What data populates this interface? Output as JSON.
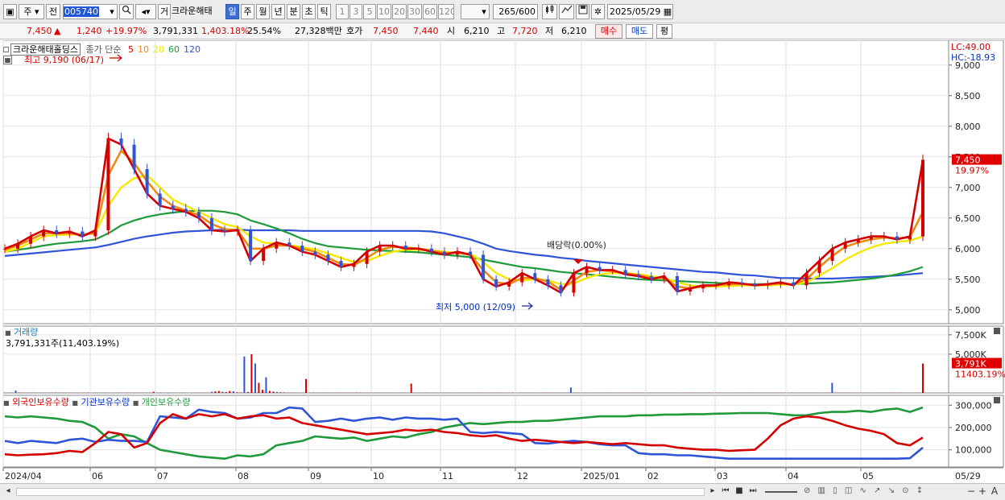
{
  "toolbar": {
    "mode_label": "주",
    "prev_label": "전",
    "code": "005740",
    "trade_label": "거",
    "stock_name": "크라운해태",
    "period_tabs": [
      "일",
      "주",
      "월",
      "년",
      "분",
      "초",
      "틱"
    ],
    "active_period": "일",
    "minute_steps": [
      "1",
      "3",
      "5",
      "10",
      "20",
      "30",
      "60",
      "120"
    ],
    "count": "265",
    "count_max": "/600",
    "date": "2025/05/29"
  },
  "quote": {
    "price": "7,450",
    "arrow": "▲",
    "change": "1,240",
    "change_pct": "+19.97%",
    "volume": "3,791,331",
    "volume_pct": "1,403.18%",
    "turnover": "25.54%",
    "amount": "27,328백만",
    "bid_label": "호가",
    "ask_price": "7,450",
    "bid_price": "7,440",
    "open_label": "시",
    "open": "6,210",
    "high_label": "고",
    "high": "7,720",
    "low_label": "저",
    "low": "6,210",
    "buy_label": "매수",
    "sell_label": "매도",
    "eval_label": "평"
  },
  "price_panel": {
    "name_tag": "크라운해태홀딩스",
    "ma_title": "종가 단순",
    "ma_periods": [
      "5",
      "10",
      "20",
      "60",
      "120"
    ],
    "ma_colors": [
      "#d40000",
      "#ee8a10",
      "#f5e800",
      "#1e9a3a",
      "#2f54d8"
    ],
    "high_note": "최고 9,190 (06/17)",
    "low_note": "최저 5,000 (12/09)",
    "dividend_note": "배당락(0.00%)",
    "lc": "LC:49.00",
    "hc": "HC:-18.93",
    "last_price_tag": "7,450",
    "last_pct_tag": "19.97%"
  },
  "volume_panel": {
    "title": "거래량",
    "value": "3,791,331주(11,403.19%)",
    "last_tag": "3,791K",
    "last_pct": "11403.19%"
  },
  "holding_panel": {
    "titles": [
      "외국인보유수량",
      "기관보유수량",
      "개인보유수량"
    ],
    "colors": [
      "#d40000",
      "#2f54d8",
      "#1e9a3a"
    ]
  },
  "bottombar": {
    "nav_icons": [
      "scroll-left-icon",
      "scroll-right-icon",
      "first-icon",
      "stop-icon",
      "last-icon",
      "zoom-out-icon",
      "zoom-in-icon",
      "text-icon"
    ],
    "zoom_text": "A"
  },
  "chart_data": [
    {
      "type": "line",
      "title": "크라운해태홀딩스",
      "subtitle": "종가 단순 5 10 20 60 120",
      "x_tick_labels": [
        "2024/04",
        "06",
        "07",
        "08",
        "09",
        "10",
        "11",
        "12",
        "2025/01",
        "02",
        "03",
        "04",
        "05",
        "05/29"
      ],
      "ylim": [
        4800,
        9300
      ],
      "y_ticks": [
        5000,
        5500,
        6000,
        6500,
        7000,
        7500,
        8000,
        8500,
        9000
      ],
      "y_tick_labels": [
        "5,000",
        "5,500",
        "6,000",
        "6,500",
        "7,000",
        "7,500",
        "8,000",
        "8,500",
        "9,000"
      ],
      "series": [
        {
          "name": "5",
          "values": [
            6000,
            6080,
            6200,
            6300,
            6250,
            6280,
            6200,
            6300,
            7800,
            7700,
            7300,
            6900,
            6700,
            6650,
            6600,
            6500,
            6300,
            6280,
            6300,
            5800,
            6000,
            6100,
            6050,
            5950,
            5900,
            5800,
            5700,
            5750,
            5950,
            6050,
            6050,
            6000,
            6000,
            5950,
            5900,
            5950,
            5900,
            5500,
            5380,
            5450,
            5600,
            5500,
            5400,
            5280,
            5600,
            5700,
            5650,
            5650,
            5580,
            5550,
            5500,
            5550,
            5300,
            5350,
            5400,
            5400,
            5450,
            5430,
            5400,
            5420,
            5450,
            5400,
            5600,
            5800,
            6000,
            6100,
            6150,
            6200,
            6200,
            6150,
            6200,
            7450
          ]
        },
        {
          "name": "10",
          "values": [
            5980,
            6050,
            6150,
            6250,
            6250,
            6250,
            6230,
            6250,
            7200,
            7600,
            7400,
            7100,
            6850,
            6700,
            6620,
            6550,
            6400,
            6320,
            6300,
            6000,
            6000,
            6050,
            6050,
            6000,
            5950,
            5850,
            5750,
            5730,
            5850,
            5980,
            6030,
            6020,
            6000,
            5970,
            5930,
            5930,
            5900,
            5650,
            5450,
            5420,
            5520,
            5520,
            5460,
            5330,
            5480,
            5620,
            5650,
            5630,
            5600,
            5570,
            5520,
            5520,
            5380,
            5350,
            5380,
            5400,
            5420,
            5420,
            5410,
            5410,
            5430,
            5410,
            5500,
            5700,
            5880,
            6030,
            6100,
            6150,
            6180,
            6170,
            6180,
            6600
          ]
        },
        {
          "name": "20",
          "values": [
            5950,
            6000,
            6100,
            6200,
            6220,
            6230,
            6230,
            6250,
            6700,
            7000,
            7150,
            7200,
            7000,
            6800,
            6700,
            6600,
            6500,
            6400,
            6350,
            6200,
            6100,
            6080,
            6060,
            6020,
            5990,
            5920,
            5850,
            5780,
            5800,
            5880,
            5950,
            5980,
            5980,
            5970,
            5950,
            5930,
            5920,
            5780,
            5600,
            5500,
            5480,
            5500,
            5480,
            5420,
            5430,
            5520,
            5580,
            5600,
            5600,
            5580,
            5550,
            5520,
            5450,
            5400,
            5380,
            5380,
            5390,
            5400,
            5400,
            5400,
            5410,
            5410,
            5450,
            5560,
            5680,
            5820,
            5930,
            6020,
            6080,
            6110,
            6130,
            6200
          ]
        },
        {
          "name": "60",
          "values": [
            5950,
            5980,
            6010,
            6050,
            6080,
            6100,
            6120,
            6150,
            6250,
            6380,
            6460,
            6520,
            6560,
            6590,
            6610,
            6620,
            6620,
            6600,
            6560,
            6460,
            6400,
            6330,
            6250,
            6160,
            6090,
            6040,
            6020,
            6000,
            5980,
            5970,
            5960,
            5950,
            5940,
            5920,
            5900,
            5880,
            5860,
            5820,
            5780,
            5740,
            5700,
            5680,
            5650,
            5620,
            5600,
            5580,
            5560,
            5540,
            5520,
            5500,
            5490,
            5480,
            5470,
            5460,
            5450,
            5440,
            5430,
            5420,
            5420,
            5420,
            5420,
            5420,
            5430,
            5440,
            5450,
            5470,
            5490,
            5510,
            5540,
            5580,
            5630,
            5700
          ]
        },
        {
          "name": "120",
          "values": [
            5880,
            5900,
            5920,
            5940,
            5960,
            5980,
            6000,
            6020,
            6060,
            6110,
            6160,
            6200,
            6230,
            6260,
            6280,
            6290,
            6300,
            6310,
            6310,
            6300,
            6300,
            6300,
            6300,
            6290,
            6290,
            6290,
            6290,
            6290,
            6290,
            6290,
            6290,
            6290,
            6290,
            6280,
            6250,
            6200,
            6150,
            6080,
            6000,
            5960,
            5930,
            5900,
            5880,
            5850,
            5830,
            5800,
            5780,
            5760,
            5740,
            5720,
            5700,
            5680,
            5660,
            5640,
            5620,
            5610,
            5590,
            5570,
            5560,
            5540,
            5520,
            5520,
            5510,
            5510,
            5510,
            5520,
            5530,
            5540,
            5550,
            5560,
            5580,
            5600
          ]
        }
      ]
    },
    {
      "type": "bar",
      "title": "거래량",
      "ylim": [
        0,
        8000000
      ],
      "y_tick_labels": [
        "7,500K",
        "5,000K"
      ],
      "values": [
        40000,
        30000,
        35000,
        300000,
        50000,
        40000,
        35000,
        30000,
        40000,
        30000,
        25000,
        30000,
        30000,
        35000,
        40000,
        38000,
        30000,
        30000,
        25000,
        20000,
        30000,
        28000,
        25000,
        35000,
        30000,
        25000,
        32000,
        28000,
        30000,
        25000,
        22000,
        30000,
        25000,
        30000,
        35000,
        30000,
        25000,
        28000,
        30000,
        25000,
        30000,
        150000,
        40000,
        30000,
        25000,
        28000,
        30000,
        22000,
        25000,
        30000,
        28000,
        25000,
        22000,
        25000,
        30000,
        28000,
        25000,
        150000,
        200000,
        250000,
        150000,
        100000,
        250000,
        220000,
        80000,
        60000,
        4700000,
        120000,
        5000000,
        3800000,
        1300000,
        400000,
        2000000,
        250000,
        180000,
        120000,
        80000,
        60000,
        40000,
        35000,
        30000,
        25000,
        20000,
        1800000,
        35000,
        40000,
        25000,
        30000,
        30000,
        25000,
        30000,
        35000,
        30000,
        25000,
        30000,
        25000,
        30000,
        50000,
        25000,
        30000,
        30000,
        25000,
        30000,
        28000,
        30000,
        25000,
        30000,
        30000,
        25000,
        28000,
        30000,
        25000,
        1200000,
        30000,
        25000,
        28000,
        30000,
        25000,
        22000,
        25000,
        30000,
        25000,
        28000,
        30000,
        25000,
        30000,
        28000,
        25000,
        25000,
        30000,
        28000,
        30000,
        25000,
        25000,
        30000,
        25000,
        30000,
        28000,
        30000,
        25000,
        30000,
        25000,
        28000,
        30000,
        25000,
        30000,
        25000,
        30000,
        28000,
        30000,
        25000,
        30000,
        25000,
        28000,
        30000,
        25000,
        700000,
        30000,
        25000,
        30000,
        28000,
        25000,
        30000,
        30000,
        28000,
        25000,
        30000,
        25000,
        25000,
        30000,
        28000,
        30000,
        25000,
        30000,
        25000,
        28000,
        30000,
        25000,
        30000,
        28000,
        25000,
        30000,
        25000,
        30000,
        28000,
        25000,
        30000,
        25000,
        30000,
        30000,
        28000,
        25000,
        30000,
        25000,
        28000,
        30000,
        25000,
        30000,
        28000,
        25000,
        30000,
        25000,
        30000,
        28000,
        25000,
        30000,
        25000,
        30000,
        28000,
        30000,
        25000,
        30000,
        25000,
        28000,
        30000,
        25000,
        30000,
        28000,
        25000,
        30000,
        25000,
        30000,
        28000,
        30000,
        25000,
        30000,
        28000,
        25000,
        1300000,
        40000,
        35000,
        30000,
        30000,
        28000,
        30000,
        25000,
        30000,
        28000,
        30000,
        25000,
        30000,
        28000,
        25000,
        30000,
        25000,
        30000,
        28000,
        30000,
        25000,
        25000,
        30000,
        28000,
        30000,
        3791331
      ]
    },
    {
      "type": "line",
      "title": "외국인보유수량 기관보유수량 개인보유수량",
      "ylim": [
        30000,
        330000
      ],
      "y_ticks": [
        100000,
        200000,
        300000
      ],
      "y_tick_labels": [
        "100,000",
        "200,000",
        "300,000"
      ],
      "series": [
        {
          "name": "외국인보유수량",
          "values": [
            80000,
            75000,
            78000,
            80000,
            85000,
            95000,
            90000,
            130000,
            180000,
            170000,
            110000,
            130000,
            220000,
            260000,
            240000,
            260000,
            250000,
            260000,
            240000,
            250000,
            255000,
            240000,
            245000,
            220000,
            210000,
            200000,
            190000,
            180000,
            170000,
            175000,
            180000,
            190000,
            185000,
            190000,
            180000,
            175000,
            165000,
            160000,
            165000,
            150000,
            140000,
            145000,
            140000,
            135000,
            130000,
            135000,
            130000,
            125000,
            130000,
            125000,
            120000,
            120000,
            110000,
            105000,
            100000,
            100000,
            95000,
            98000,
            100000,
            150000,
            210000,
            240000,
            250000,
            245000,
            230000,
            210000,
            195000,
            185000,
            170000,
            130000,
            120000,
            155000
          ]
        },
        {
          "name": "기관보유수량",
          "values": [
            140000,
            130000,
            140000,
            135000,
            130000,
            145000,
            150000,
            135000,
            145000,
            140000,
            140000,
            135000,
            250000,
            245000,
            240000,
            280000,
            270000,
            265000,
            240000,
            245000,
            265000,
            265000,
            290000,
            285000,
            225000,
            230000,
            240000,
            230000,
            240000,
            245000,
            235000,
            245000,
            240000,
            240000,
            235000,
            240000,
            180000,
            175000,
            180000,
            175000,
            170000,
            130000,
            128000,
            135000,
            140000,
            135000,
            125000,
            120000,
            120000,
            85000,
            80000,
            80000,
            75000,
            75000,
            70000,
            65000,
            60000,
            60000,
            60000,
            60000,
            60000,
            60000,
            60000,
            60000,
            60000,
            60000,
            60000,
            60000,
            60000,
            60000,
            62000,
            110000
          ]
        },
        {
          "name": "개인보유수량",
          "values": [
            250000,
            245000,
            250000,
            245000,
            240000,
            230000,
            225000,
            200000,
            150000,
            170000,
            160000,
            130000,
            100000,
            90000,
            80000,
            70000,
            65000,
            60000,
            75000,
            70000,
            80000,
            120000,
            130000,
            140000,
            160000,
            155000,
            150000,
            155000,
            140000,
            150000,
            160000,
            155000,
            170000,
            180000,
            200000,
            210000,
            220000,
            215000,
            220000,
            225000,
            225000,
            230000,
            230000,
            235000,
            240000,
            245000,
            250000,
            250000,
            250000,
            255000,
            255000,
            258000,
            258000,
            260000,
            260000,
            262000,
            263000,
            265000,
            265000,
            265000,
            260000,
            255000,
            255000,
            265000,
            270000,
            270000,
            275000,
            270000,
            280000,
            285000,
            270000,
            290000
          ]
        }
      ]
    }
  ]
}
